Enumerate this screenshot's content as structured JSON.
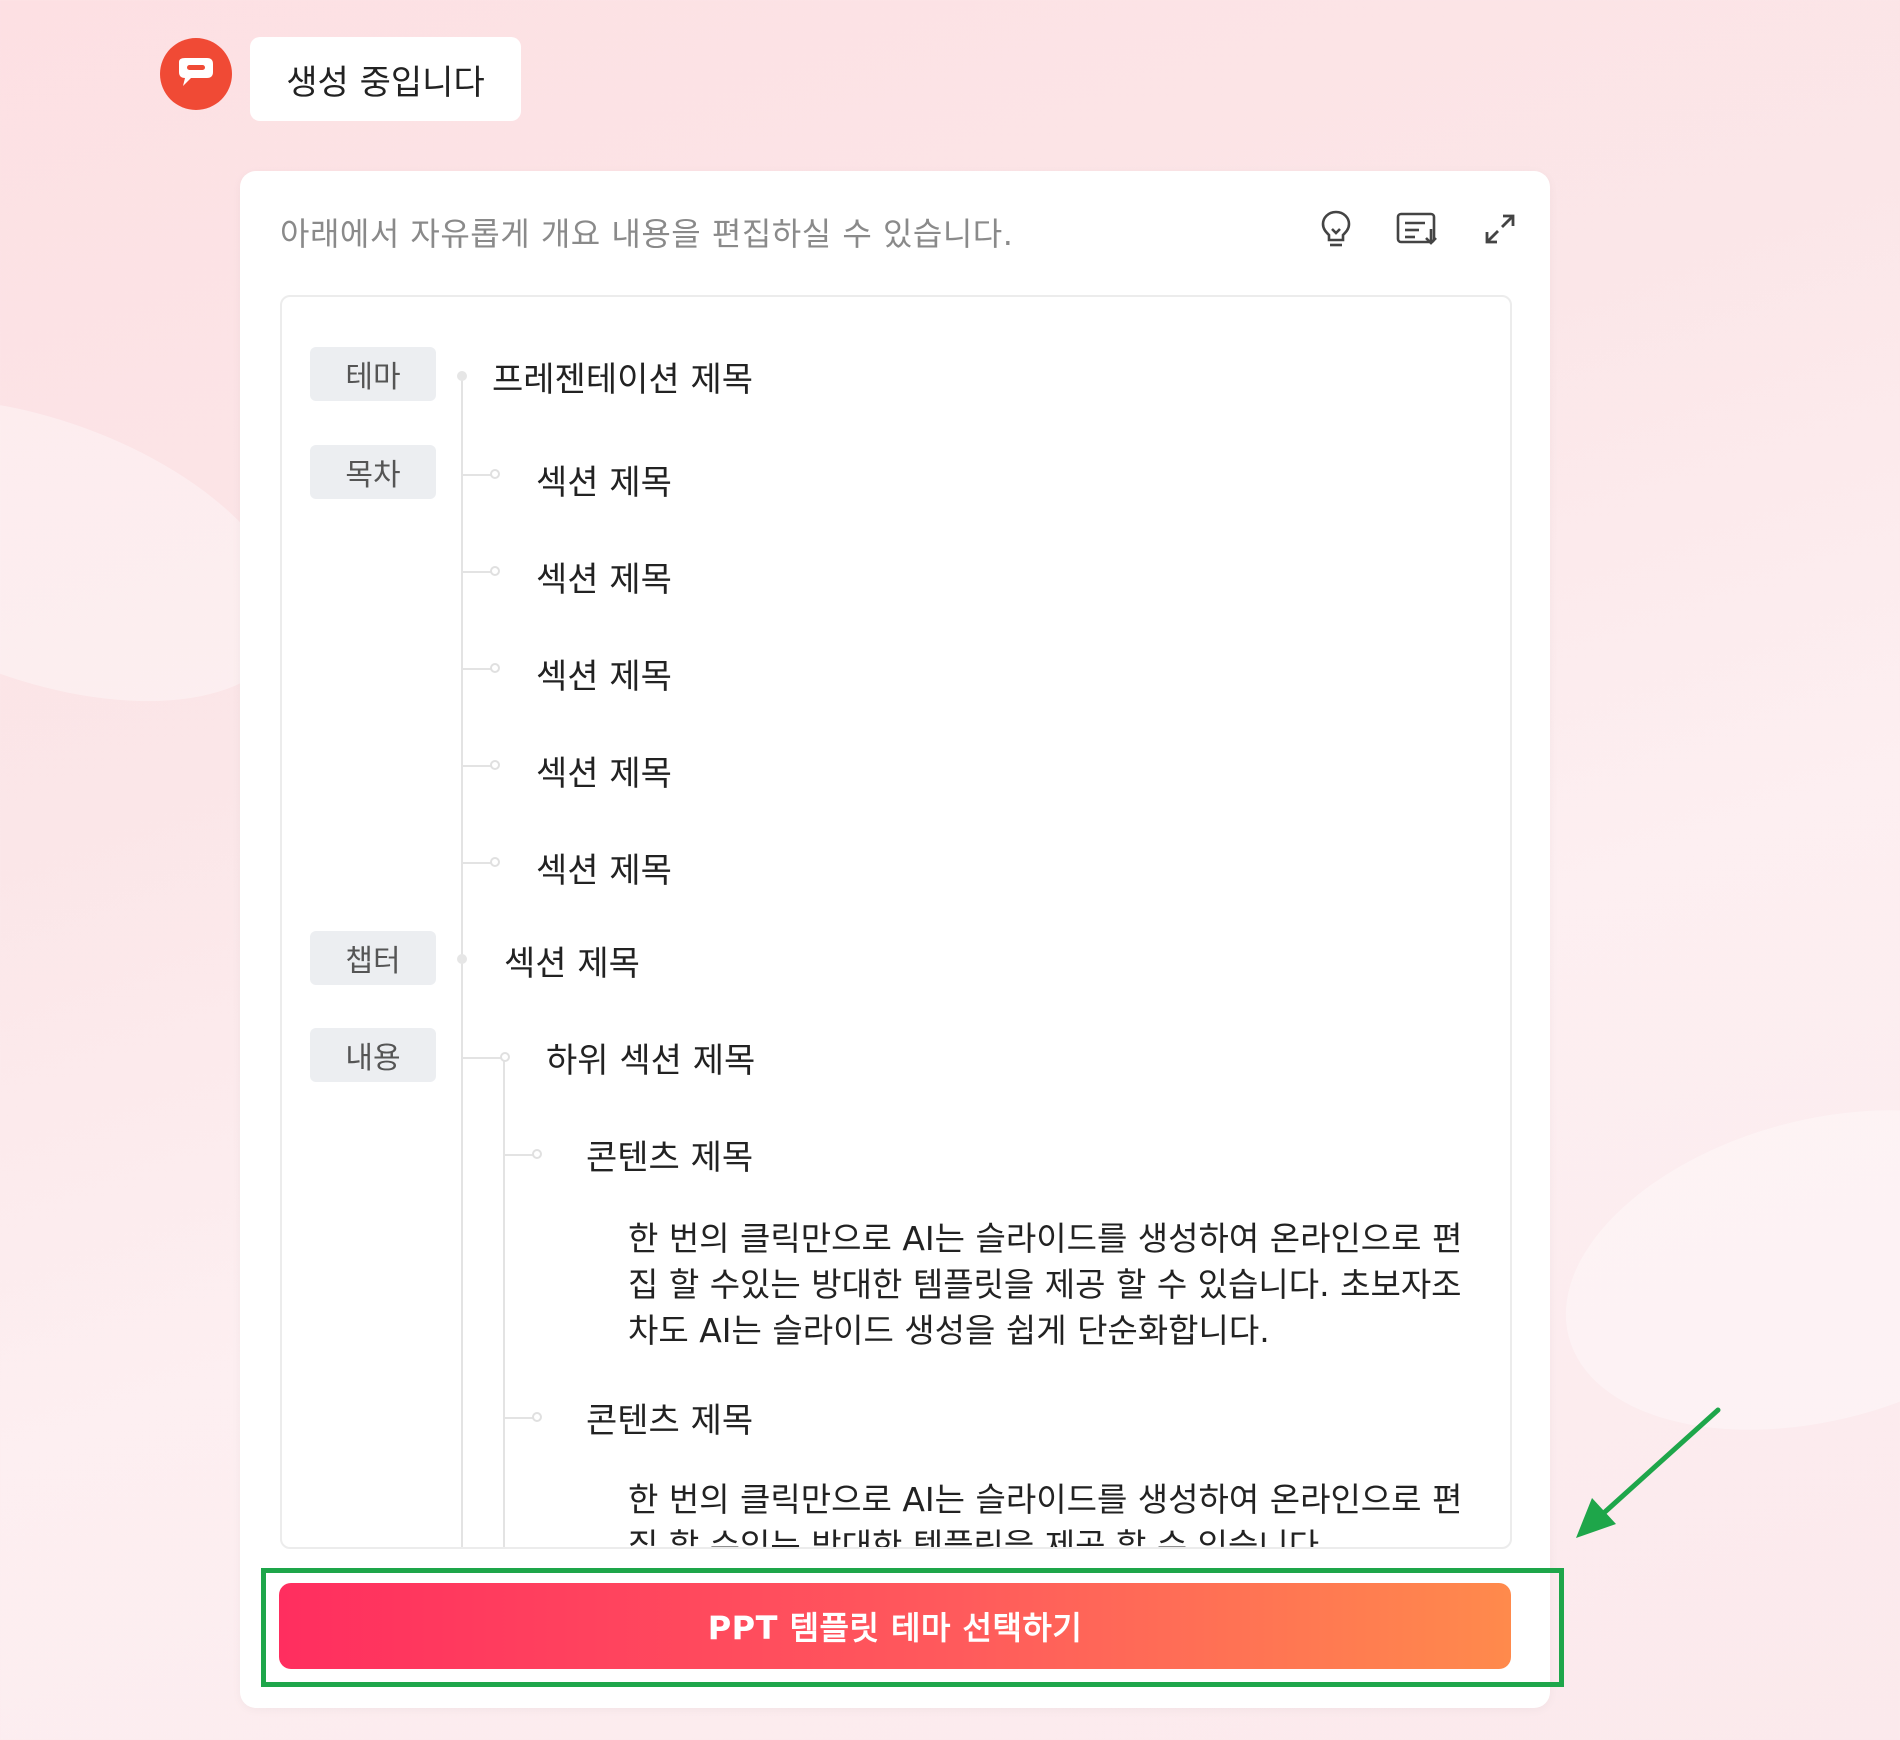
{
  "header": {
    "status_text": "생성 중입니다"
  },
  "editor": {
    "hint": "아래에서 자유롭게 개요 내용을 편집하실 수 있습니다.",
    "toolbar": {
      "icons": [
        "lightbulb-icon",
        "import-list-icon",
        "expand-icon"
      ]
    }
  },
  "outline": {
    "labels": {
      "theme": "테마",
      "toc": "목차",
      "chapter": "챕터",
      "content": "내용"
    },
    "title": "프레젠테이션 제목",
    "toc_items": [
      "섹션 제목",
      "섹션 제목",
      "섹션 제목",
      "섹션 제목",
      "섹션 제목"
    ],
    "chapter_title": "섹션 제목",
    "subsection_title": "하위 섹션 제목",
    "contents": [
      {
        "title": "콘텐츠 제목",
        "body": "한 번의 클릭만으로 AI는 슬라이드를 생성하여 온라인으로 편집 할 수있는 방대한 템플릿을 제공 할 수 있습니다. 초보자조차도 AI는 슬라이드 생성을 쉽게 단순화합니다."
      },
      {
        "title": "콘텐츠 제목",
        "body": "한 번의 클릭만으로 AI는 슬라이드를 생성하여 온라인으로 편집 할 수있는 방대한 템플릿을 제공 할 수 있습니다."
      }
    ]
  },
  "cta": {
    "label": "PPT 템플릿 테마 선택하기"
  },
  "colors": {
    "brand_logo": "#f04a35",
    "cta_start": "#ff2e5f",
    "cta_end": "#ff8a4c",
    "highlight": "#1ea64a"
  }
}
